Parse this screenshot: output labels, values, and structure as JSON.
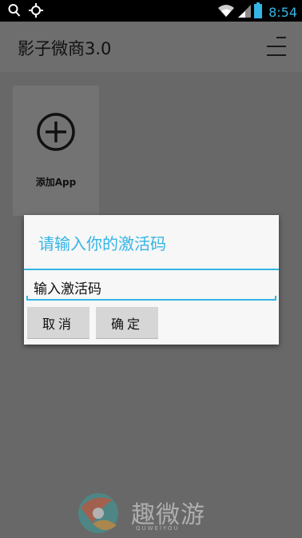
{
  "status_bar": {
    "time": "8:54",
    "left_icons": [
      "search-icon",
      "gps-icon"
    ],
    "right_icons": [
      "wifi-icon",
      "signal-icon",
      "battery-icon"
    ]
  },
  "action_bar": {
    "title": "影子微商3.0",
    "menu_icon": "menu-icon"
  },
  "tile": {
    "label": "添加App",
    "icon": "add-circle-icon"
  },
  "dialog": {
    "title": "请输入你的激活码",
    "input_value": "输入激活码",
    "cancel_label": "取消",
    "confirm_label": "确定"
  },
  "watermark": {
    "text": "趣微游",
    "subtext": "QUWEIYOU"
  },
  "colors": {
    "accent": "#33b5e5",
    "status_bar": "#000000",
    "dialog_bg": "#f7f7f7"
  }
}
